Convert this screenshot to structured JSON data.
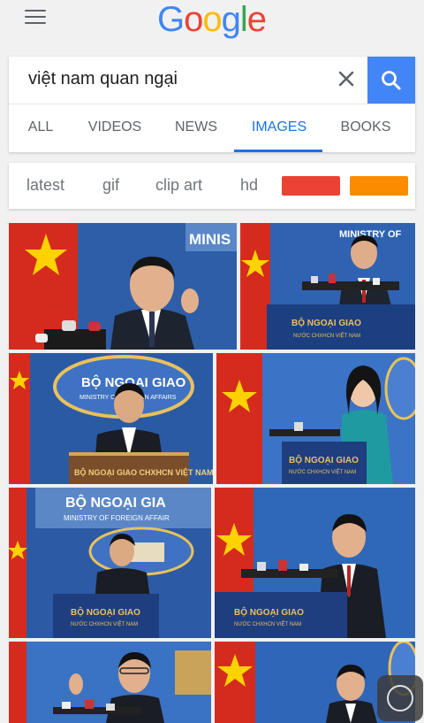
{
  "header": {
    "logo_letters": [
      "G",
      "o",
      "o",
      "g",
      "l",
      "e"
    ]
  },
  "search": {
    "query": "việt nam quan ngại"
  },
  "tabs": [
    {
      "label": "ALL"
    },
    {
      "label": "VIDEOS"
    },
    {
      "label": "NEWS"
    },
    {
      "label": "IMAGES"
    },
    {
      "label": "BOOKS"
    }
  ],
  "filters": {
    "chips": [
      "latest",
      "gif",
      "clip art",
      "hd"
    ],
    "color_swatches": [
      "#ea4335",
      "#fb8c00"
    ]
  },
  "results": {
    "thumbs": [
      {
        "sign_text": "MINIS"
      },
      {
        "sign_text": "MINISTRY OF",
        "podium_text": "BỘ NGOẠI GIAO",
        "podium_subtext": "NƯỚC CHXHCN VIỆT NAM"
      },
      {
        "emblem_text": "BỘ NGOẠI GIAO",
        "emblem_subtext": "MINISTRY OF FOREIGN AFFAIRS",
        "podium_text": "BỘ NGOẠI GIAO CHXHCN VIỆT NAM"
      },
      {
        "podium_text": "BỘ NGOẠI GIAO",
        "podium_subtext": "NƯỚC CHXHCN VIỆT NAM"
      },
      {
        "sign_text": "BỘ NGOẠI GIA",
        "sign_subtext": "MINISTRY OF FOREIGN AFFAIR",
        "podium_text": "BỘ NGOẠI GIAO",
        "podium_subtext": "NƯỚC CHXHCN VIỆT NAM"
      },
      {
        "podium_text": "BỘ NGOẠI GIAO",
        "podium_subtext": "NƯỚC CHXHCN VIỆT NAM"
      },
      {},
      {}
    ]
  },
  "colors": {
    "accent": "#1a73e8",
    "search_button": "#4285f4",
    "backdrop_blue": "#2e5ea8",
    "flag_red": "#d52b1e",
    "flag_star": "#ffd200"
  }
}
